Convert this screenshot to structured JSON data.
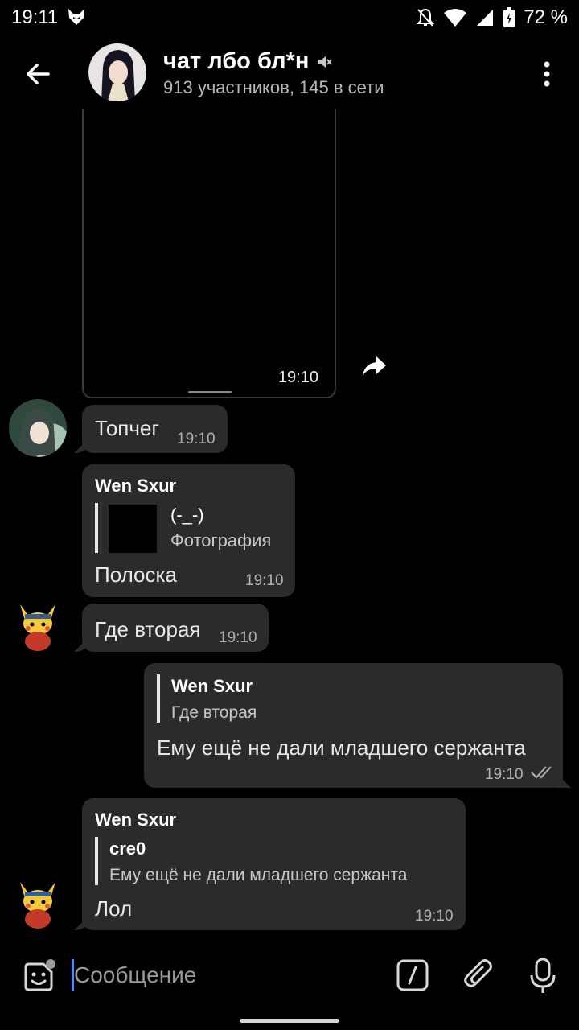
{
  "status_bar": {
    "time": "19:11",
    "battery": "72 %"
  },
  "header": {
    "title": "чат лбо бл*н",
    "subtitle": "913 участников, 145 в сети"
  },
  "messages": {
    "photo_time": "19:10",
    "m1": {
      "text": "Топчег",
      "time": "19:10"
    },
    "m2": {
      "author": "Wen Sxur",
      "quote_title": "(-_-)",
      "quote_text": "Фотография",
      "text": "Полоска",
      "time": "19:10"
    },
    "m3": {
      "text": "Где вторая",
      "time": "19:10"
    },
    "m4": {
      "quote_author": "Wen Sxur",
      "quote_text": "Где вторая",
      "text": "Ему ещё не дали младшего сержанта",
      "time": "19:10"
    },
    "m5": {
      "author": "Wen Sxur",
      "quote_author": "cre0",
      "quote_text": "Ему ещё не дали младшего сержанта",
      "text": "Лол",
      "time": "19:10"
    }
  },
  "input": {
    "placeholder": "Сообщение"
  },
  "colors": {
    "background": "#000000",
    "bubble": "#2b2b2b",
    "accent_cursor": "#4a8cff"
  }
}
